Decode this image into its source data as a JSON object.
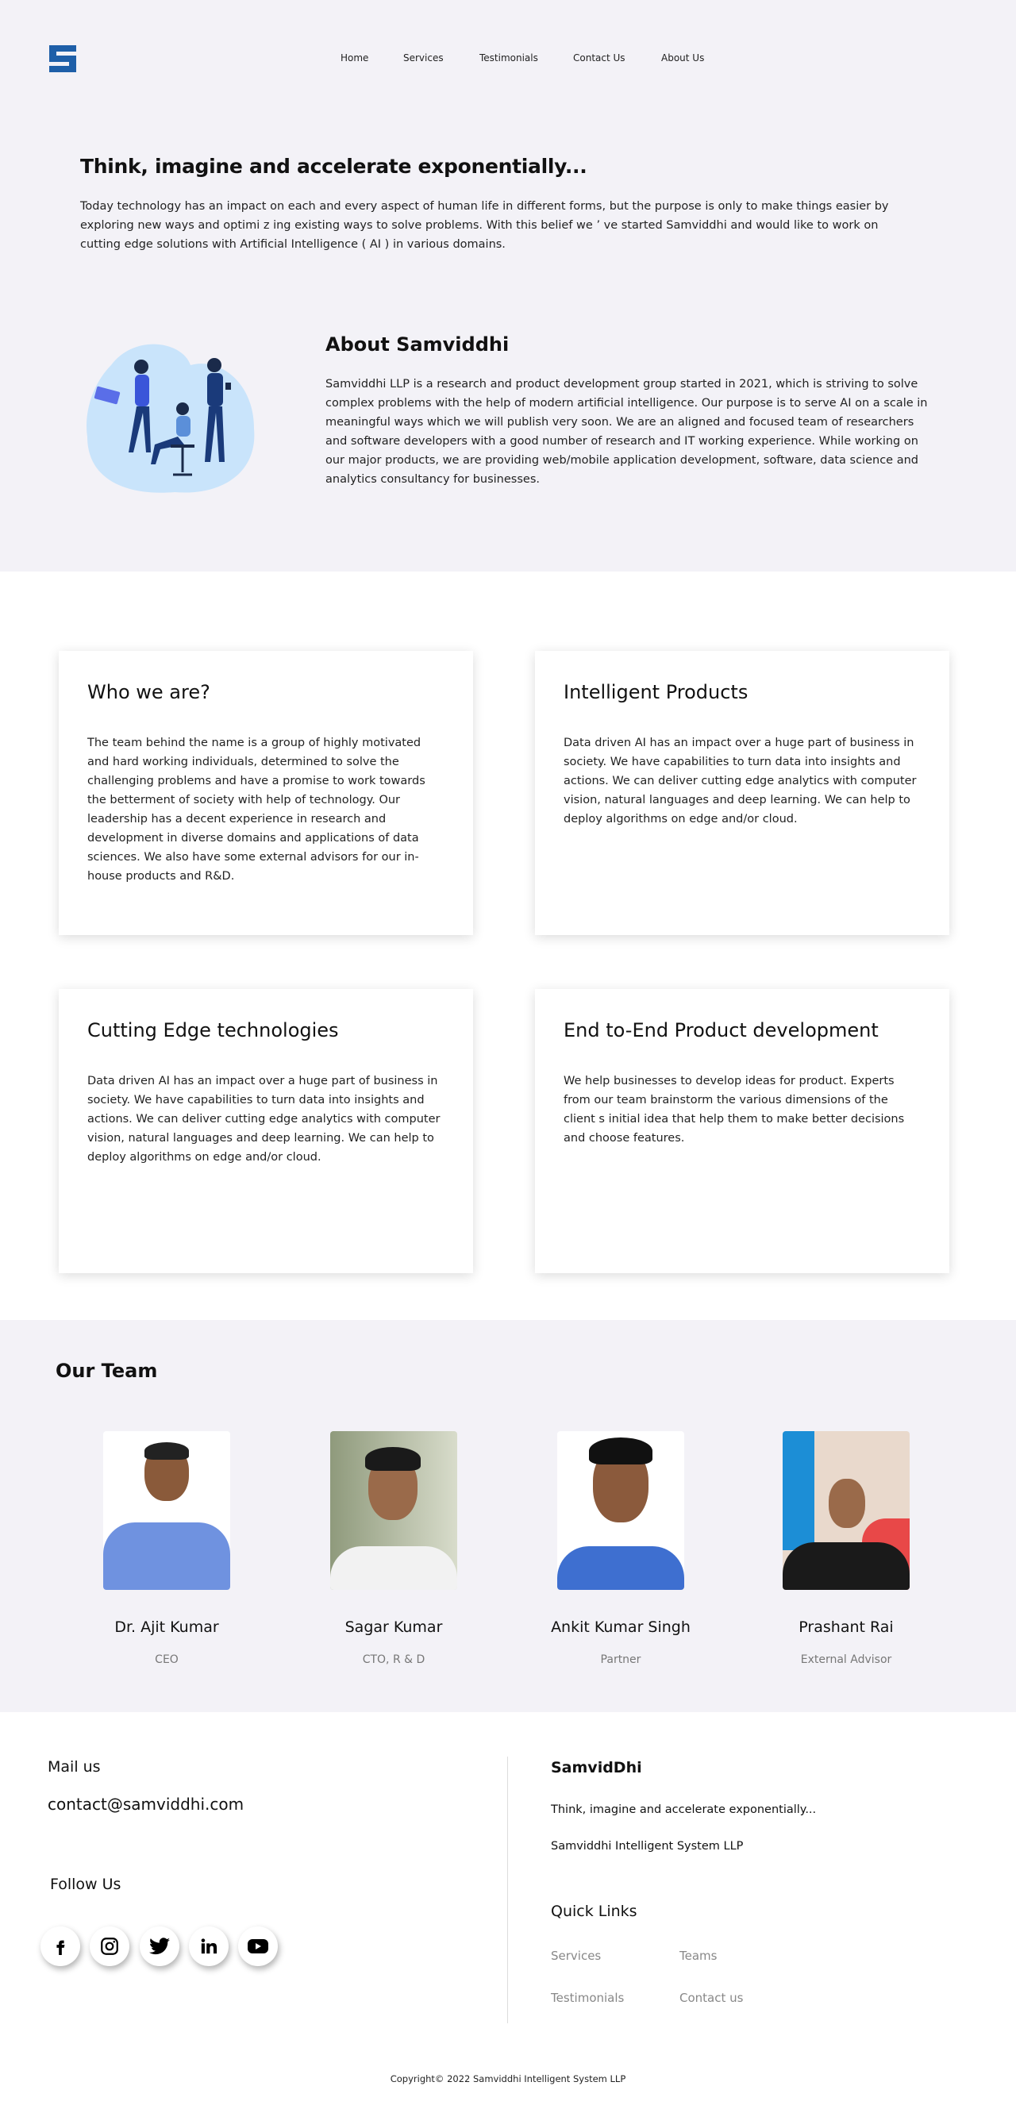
{
  "nav": {
    "items": [
      "Home",
      "Services",
      "Testimonials",
      "Contact Us",
      "About Us"
    ]
  },
  "hero": {
    "title": "Think, imagine and accelerate exponentially...",
    "text": "Today technology has an impact on each and every aspect of human life in different forms, but the purpose is only to make things easier by exploring new ways and optimi z ing existing ways to solve problems. With this belief we ’ ve started Samviddhi and would like to work on cutting edge solutions with Artificial Intelligence ( AI ) in various domains."
  },
  "about": {
    "title": "About Samviddhi",
    "text": "Samviddhi LLP is a research and product development group started in 2021, which is striving to solve complex problems with the help of modern artificial intelligence. Our purpose is to serve AI on a scale in meaningful ways which we will publish very soon. We are an aligned and focused team of researchers and software developers with a good number of research and IT working experience. While working on our major products, we are providing web/mobile application development, software, data science and analytics consultancy for businesses."
  },
  "cards": [
    {
      "title": "Who we are?",
      "text": "The team behind the name is a group of highly motivated and hard working individuals, determined to solve the challenging problems and have a promise to work towards the betterment of society with help of technology. Our leadership has a decent experience in research and development in diverse domains and applications of data sciences. We also have some external advisors for our in-house products and R&D."
    },
    {
      "title": "Intelligent Products",
      "text": "Data driven AI has an impact over a huge part of business in society. We have capabilities to turn data into insights and actions. We can deliver cutting edge analytics with computer vision, natural languages and deep learning. We can help to deploy algorithms on edge and/or cloud."
    },
    {
      "title": "Cutting Edge technologies",
      "text": "Data driven AI has an impact over a huge part of business in society. We have capabilities to turn data into insights and actions. We can deliver cutting edge analytics with computer vision, natural languages and deep learning. We can help to deploy algorithms on edge and/or cloud."
    },
    {
      "title": "End to-End Product development",
      "text": "We help businesses to develop ideas for product. Experts from our team brainstorm the various dimensions of the client s initial idea that help them to make better decisions and choose features."
    }
  ],
  "team": {
    "title": "Our Team",
    "members": [
      {
        "name": "Dr. Ajit Kumar",
        "role": "CEO"
      },
      {
        "name": "Sagar Kumar",
        "role": "CTO, R & D"
      },
      {
        "name": "Ankit Kumar Singh",
        "role": "Partner"
      },
      {
        "name": "Prashant Rai",
        "role": "External Advisor"
      }
    ]
  },
  "footer": {
    "mail_label": "Mail us",
    "email": "contact@samviddhi.com",
    "follow_label": "Follow Us",
    "social": [
      "facebook-icon",
      "instagram-icon",
      "twitter-icon",
      "linkedin-icon",
      "youtube-icon"
    ],
    "brand": "SamvidDhi",
    "tagline": "Think, imagine and accelerate exponentially...",
    "company": "Samviddhi Intelligent System LLP",
    "quick_links_title": "Quick Links",
    "links": [
      "Services",
      "Teams",
      "Testimonials",
      "Contact us"
    ],
    "copyright": "Copyright© 2022 Samviddhi Intelligent System LLP"
  },
  "colors": {
    "brand_blue": "#1e5fa8",
    "bg": "#f3f2f7"
  }
}
